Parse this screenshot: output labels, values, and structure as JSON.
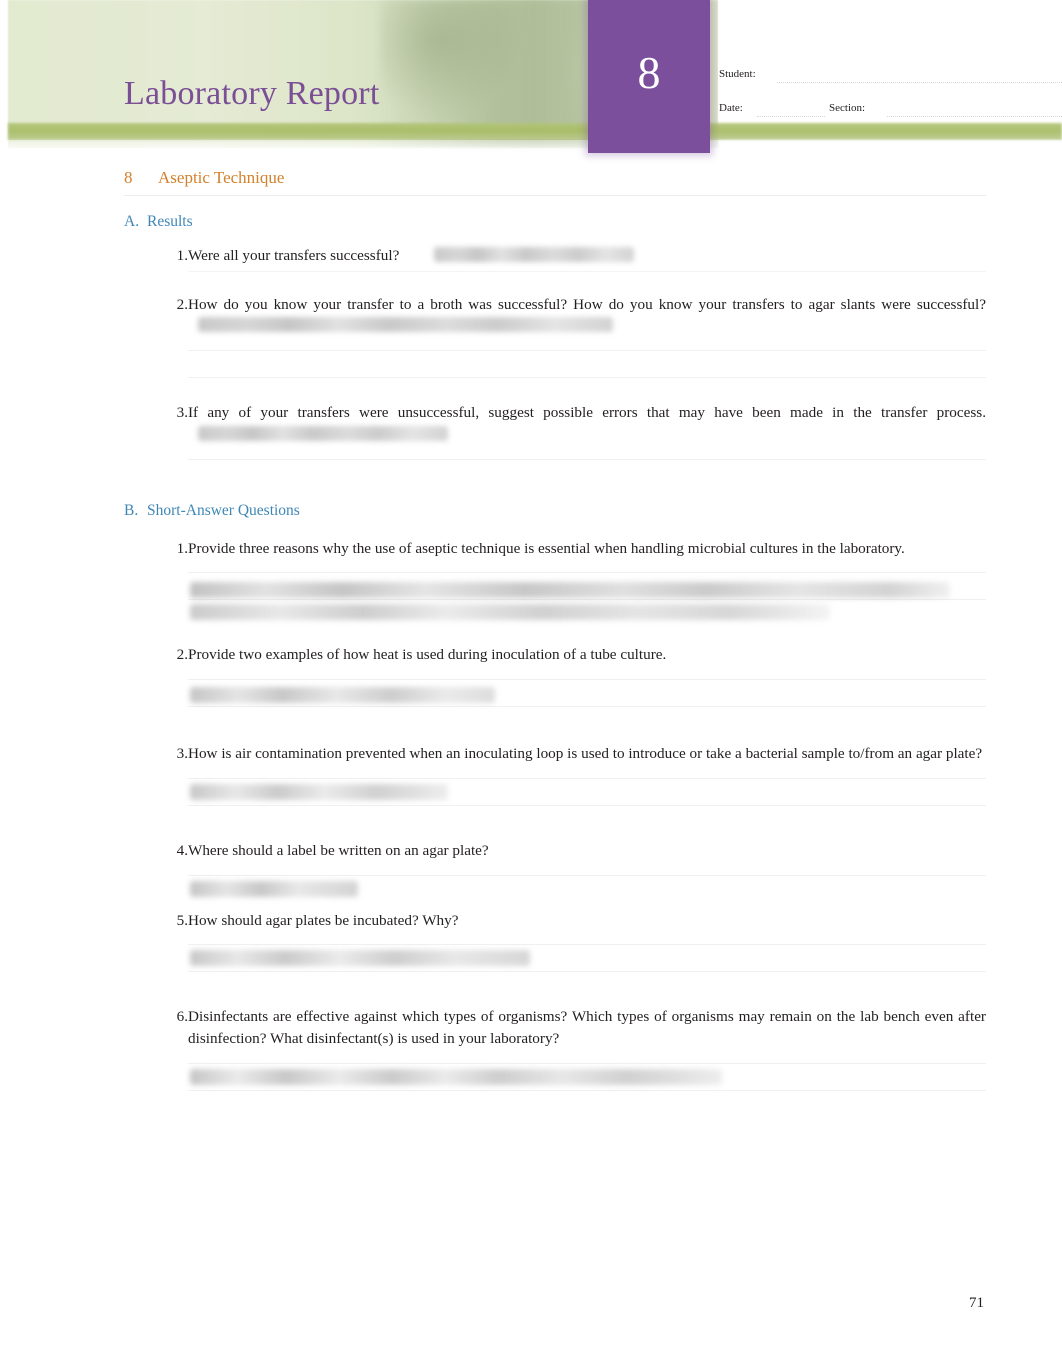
{
  "header": {
    "title": "Laboratory Report",
    "lab_number": "8",
    "meta": [
      {
        "label": "Student:"
      },
      {
        "label": "Date:"
      },
      {
        "label": "Section:"
      }
    ],
    "colors": {
      "title_purple": "#7b4f96",
      "number_box_purple": "#7c4f9c",
      "banner_green": "#e2ead0",
      "green_bar": "#a8bd66"
    }
  },
  "chapter": {
    "number": "8",
    "title": "Aseptic Technique",
    "color": "#d2822c"
  },
  "sections": [
    {
      "letter": "A.",
      "title": "Results",
      "color": "#3f86b5",
      "questions": [
        {
          "number": "1.",
          "text": "Were all your transfers successful?",
          "answer_lines": 0
        },
        {
          "number": "2.",
          "text": "How do you know your transfer to a broth was successful? How do you know your transfers to agar slants were successful?",
          "answer_lines": 2
        },
        {
          "number": "3.",
          "text": "If any of your transfers were unsuccessful, suggest possible errors that may have been made in the transfer process.",
          "answer_lines": 1
        }
      ]
    },
    {
      "letter": "B.",
      "title": "Short-Answer  Questions",
      "color": "#3f86b5",
      "questions": [
        {
          "number": "1.",
          "text": "Provide three reasons why the use of aseptic technique is essential when handling microbial cultures in the laboratory.",
          "answer_lines": 2
        },
        {
          "number": "2.",
          "text": "Provide two examples of how heat is used during inoculation of a tube culture.",
          "answer_lines": 2
        },
        {
          "number": "3.",
          "text": "How is air contamination prevented when an inoculating loop is used to introduce or take a bacterial sample to/from an agar plate?",
          "answer_lines": 2
        },
        {
          "number": "4.",
          "text": "Where should a label be written on an agar plate?",
          "answer_lines": 1
        },
        {
          "number": "5.",
          "text": "How should agar plates be incubated? Why?",
          "answer_lines": 2
        },
        {
          "number": "6.",
          "text": "Disinfectants are effective against which types of organisms? Which types of organisms may remain on the lab bench even after disinfection? What disinfectant(s) is used in your laboratory?",
          "answer_lines": 2
        }
      ]
    }
  ],
  "footer": {
    "page_number": "71"
  }
}
